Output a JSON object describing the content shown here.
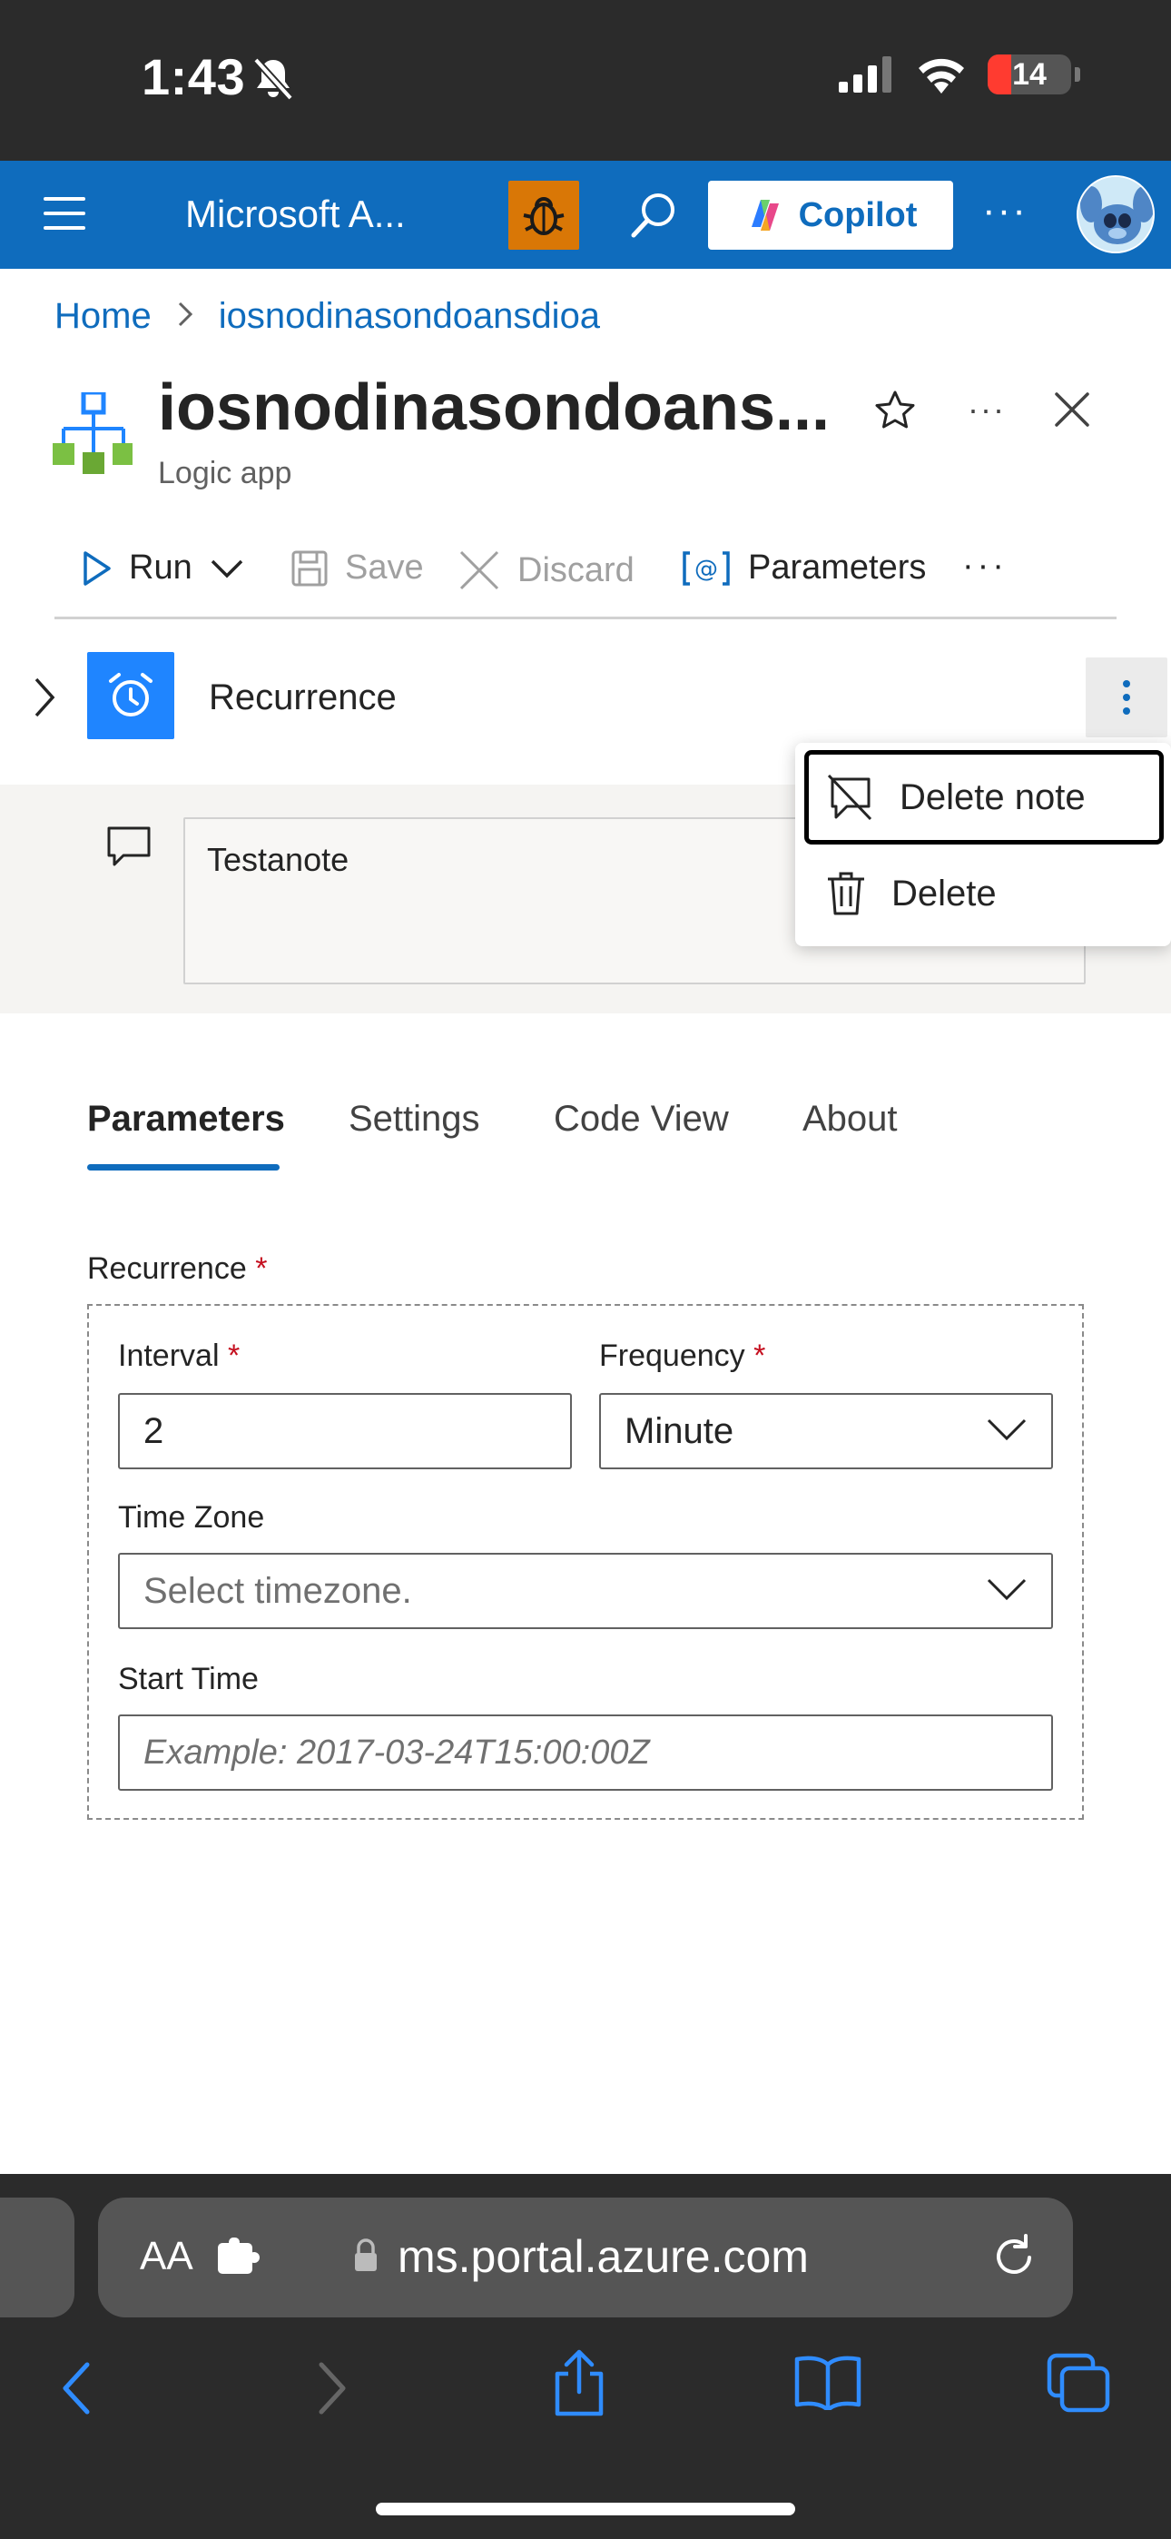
{
  "status_bar": {
    "time": "1:43",
    "battery": "14",
    "battery_color": "#ff3b30"
  },
  "header": {
    "app_title": "Microsoft A...",
    "copilot_label": "Copilot",
    "more_label": "···",
    "brand_color": "#0f6cbd",
    "bug_button_color": "#d97706"
  },
  "breadcrumb": {
    "items": [
      "Home",
      "iosnodinasondoansdioa"
    ]
  },
  "resource": {
    "title": "iosnodinasondoans...",
    "subtitle": "Logic app",
    "more_label": "···"
  },
  "command_bar": {
    "run": "Run",
    "save": "Save",
    "discard": "Discard",
    "parameters": "Parameters",
    "more": "···"
  },
  "node": {
    "title": "Recurrence",
    "icon": "alarm-clock-icon",
    "icon_color": "#1f85ff"
  },
  "note": {
    "text": "Testanote"
  },
  "context_menu": {
    "items": [
      {
        "label": "Delete note",
        "icon": "comment-off-icon"
      },
      {
        "label": "Delete",
        "icon": "trash-icon"
      }
    ]
  },
  "tabs": {
    "items": [
      "Parameters",
      "Settings",
      "Code View",
      "About"
    ],
    "active": "Parameters"
  },
  "form": {
    "group_label": "Recurrence",
    "required_mark": "*",
    "interval": {
      "label": "Interval",
      "value": "2"
    },
    "frequency": {
      "label": "Frequency",
      "value": "Minute"
    },
    "time_zone": {
      "label": "Time Zone",
      "placeholder": "Select timezone."
    },
    "start_time": {
      "label": "Start Time",
      "placeholder": "Example: 2017-03-24T15:00:00Z"
    }
  },
  "browser": {
    "aa_label": "AA",
    "url": "ms.portal.azure.com"
  }
}
